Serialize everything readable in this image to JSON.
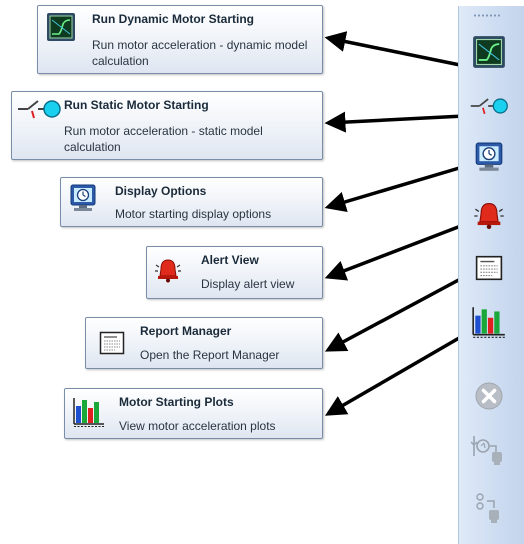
{
  "tooltips": [
    {
      "id": "dynamic",
      "icon": "dynamic-motor-starting-icon",
      "title": "Run Dynamic Motor Starting",
      "description": "Run motor acceleration - dynamic model calculation"
    },
    {
      "id": "static",
      "icon": "static-motor-starting-icon",
      "title": "Run Static Motor Starting",
      "description": "Run motor acceleration - static model calculation"
    },
    {
      "id": "display",
      "icon": "display-options-icon",
      "title": "Display Options",
      "description": "Motor starting display options"
    },
    {
      "id": "alert",
      "icon": "alert-bell-icon",
      "title": "Alert View",
      "description": "Display alert view"
    },
    {
      "id": "report",
      "icon": "report-manager-icon",
      "title": "Report Manager",
      "description": "Open the Report Manager"
    },
    {
      "id": "plots",
      "icon": "bar-plot-icon",
      "title": "Motor Starting Plots",
      "description": "View motor acceleration plots"
    }
  ],
  "toolbar": {
    "buttons": [
      {
        "icon": "dynamic-motor-starting-icon",
        "enabled": true
      },
      {
        "icon": "static-motor-starting-icon",
        "enabled": true
      },
      {
        "icon": "display-options-icon",
        "enabled": true
      },
      {
        "icon": "alert-bell-icon",
        "enabled": true
      },
      {
        "icon": "report-manager-icon",
        "enabled": true
      },
      {
        "icon": "bar-plot-icon",
        "enabled": true
      },
      {
        "icon": "stop-icon",
        "enabled": false
      },
      {
        "icon": "motor-relay-icon",
        "enabled": false
      },
      {
        "icon": "switch-device-icon",
        "enabled": false
      }
    ]
  },
  "colors": {
    "tooltip_border": "#7a8da8",
    "toolbar_bg": "#cddcf1",
    "arrow": "#000000"
  }
}
